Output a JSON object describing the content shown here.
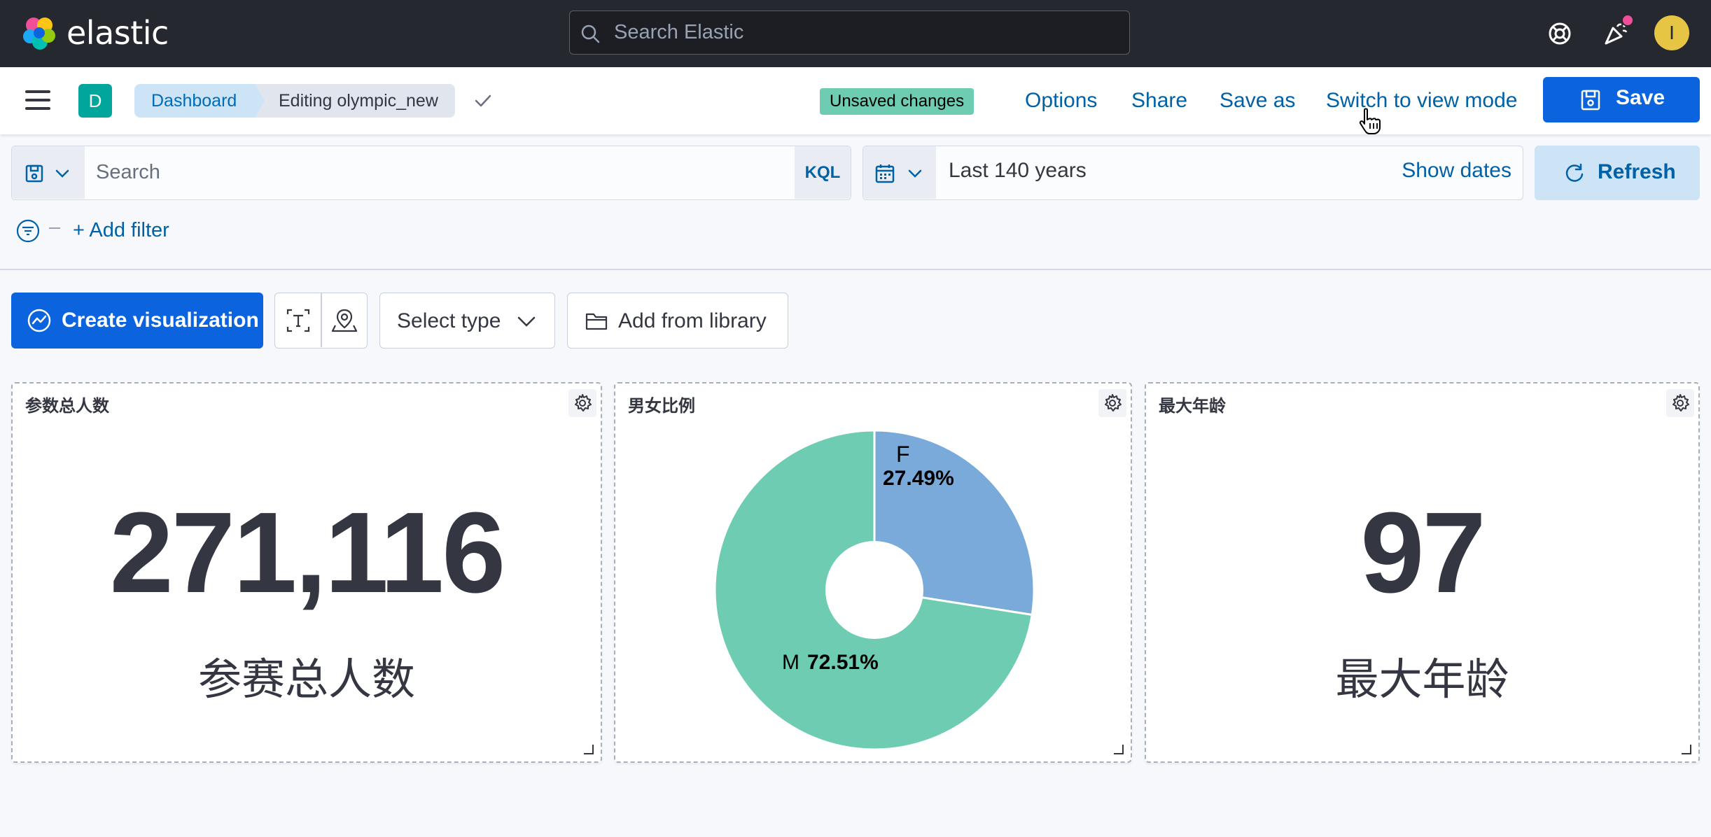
{
  "header": {
    "logo_text": "elastic",
    "search_placeholder": "Search Elastic",
    "user_initial": "I"
  },
  "subheader": {
    "space_initial": "D",
    "breadcrumbs": [
      "Dashboard",
      "Editing olympic_new"
    ],
    "unsaved_badge": "Unsaved changes",
    "links": {
      "options": "Options",
      "share": "Share",
      "save_as": "Save as",
      "switch_view": "Switch to view mode"
    },
    "save_label": "Save"
  },
  "query_bar": {
    "search_placeholder": "Search",
    "language": "KQL",
    "date_range": "Last 140 years",
    "show_dates": "Show dates",
    "refresh_label": "Refresh",
    "add_filter": "+ Add filter"
  },
  "toolbar": {
    "create_visualization": "Create visualization",
    "select_type": "Select type",
    "add_from_library": "Add from library"
  },
  "panels": [
    {
      "title": "参数总人数",
      "value": "271,116",
      "label": "参赛总人数"
    },
    {
      "title": "男女比例"
    },
    {
      "title": "最大年龄",
      "value": "97",
      "label": "最大年龄"
    }
  ],
  "chart_data": {
    "type": "pie",
    "donut": true,
    "categories": [
      "F",
      "M"
    ],
    "values": [
      27.49,
      72.51
    ],
    "labels": [
      "27.49%",
      "72.51%"
    ],
    "colors": [
      "#79aad9",
      "#6dccb1"
    ]
  }
}
